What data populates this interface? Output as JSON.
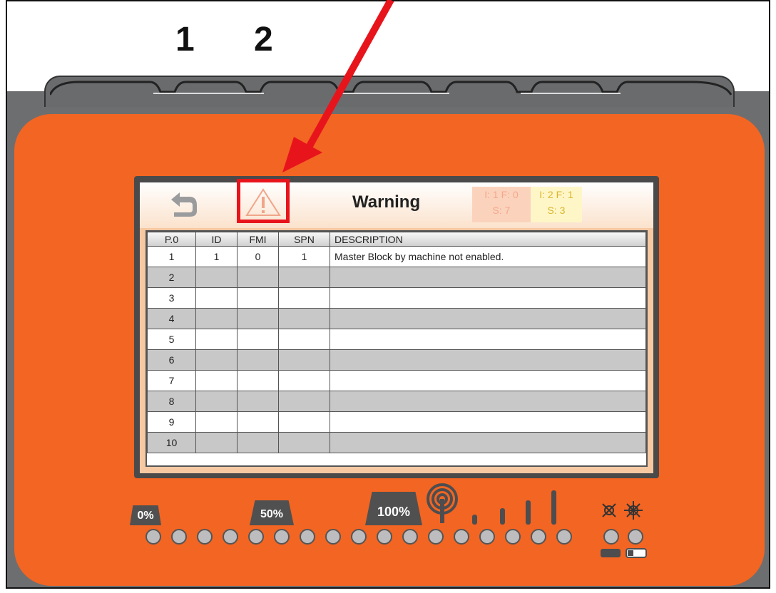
{
  "keys": [
    "1",
    "2"
  ],
  "header": {
    "title": "Warning",
    "status_counts_red": {
      "line1": "I: 1  F: 0",
      "line2": "S: 7"
    },
    "status_counts_yellow": {
      "line1": "I: 2  F: 1",
      "line2": "S: 3"
    }
  },
  "table": {
    "columns": [
      "P.0",
      "ID",
      "FMI",
      "SPN",
      "DESCRIPTION"
    ],
    "rows": [
      [
        "1",
        "1",
        "0",
        "1",
        "Master Block by machine not enabled."
      ],
      [
        "2",
        "",
        "",
        "",
        ""
      ],
      [
        "3",
        "",
        "",
        "",
        ""
      ],
      [
        "4",
        "",
        "",
        "",
        ""
      ],
      [
        "5",
        "",
        "",
        "",
        ""
      ],
      [
        "6",
        "",
        "",
        "",
        ""
      ],
      [
        "7",
        "",
        "",
        "",
        ""
      ],
      [
        "8",
        "",
        "",
        "",
        ""
      ],
      [
        "9",
        "",
        "",
        "",
        ""
      ],
      [
        "10",
        "",
        "",
        "",
        ""
      ]
    ]
  },
  "indicators": {
    "level_labels": [
      "0%",
      "50%",
      "100%"
    ]
  },
  "colors": {
    "body": "#f26522",
    "highlight": "#e8141c"
  }
}
